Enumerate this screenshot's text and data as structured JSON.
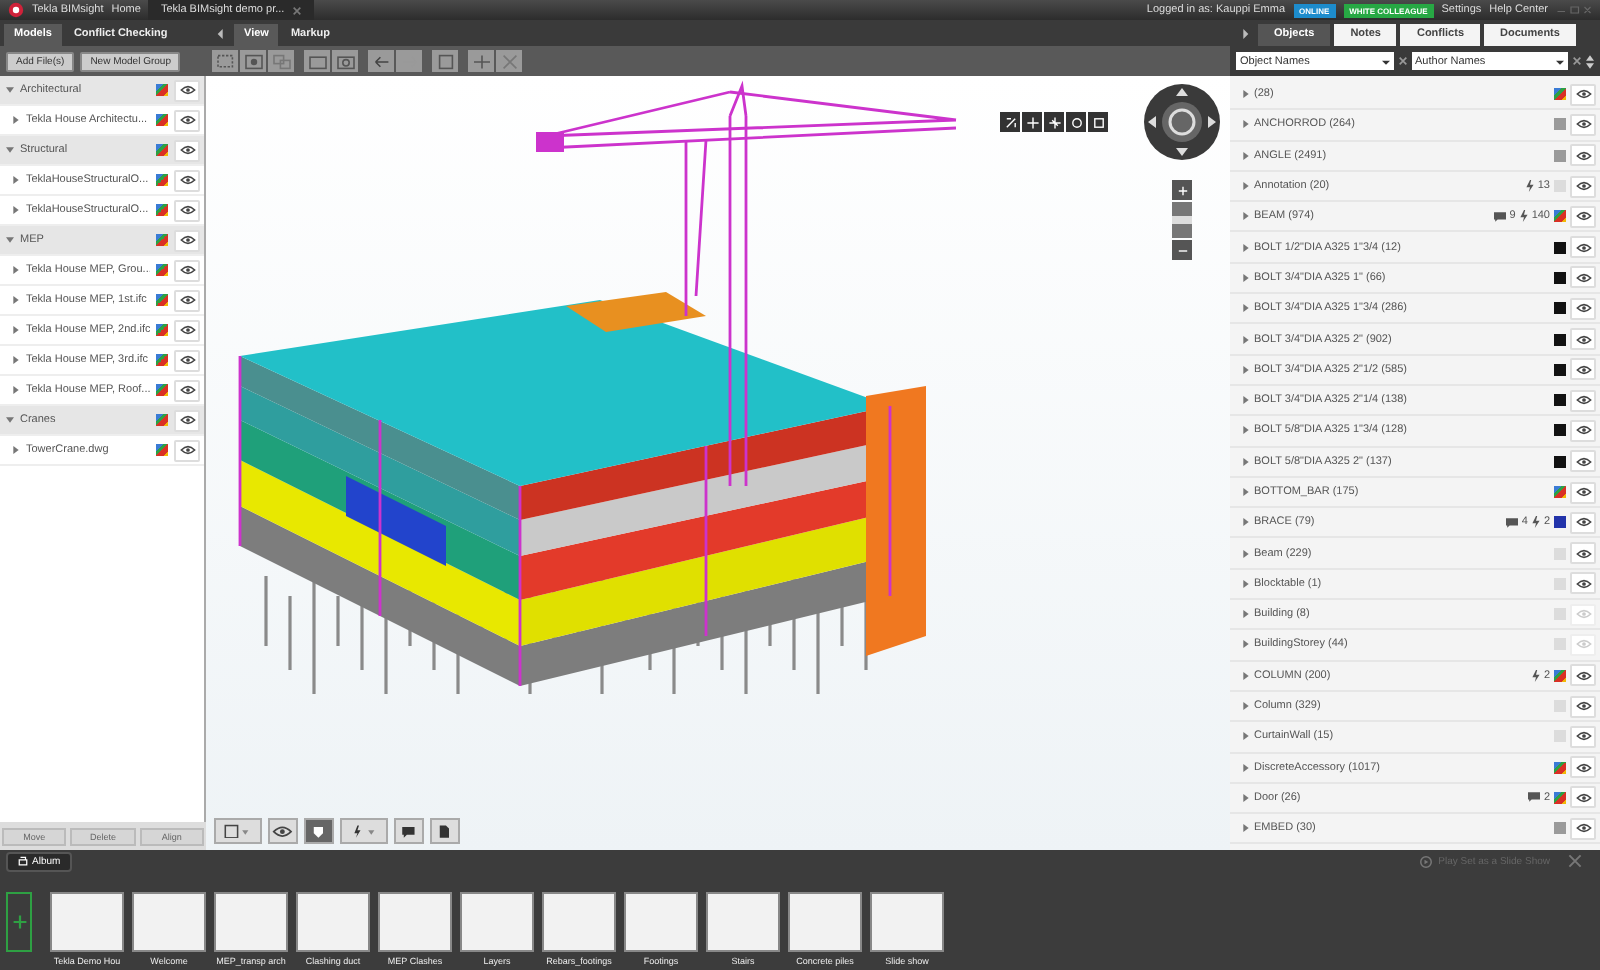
{
  "title_bar": {
    "app_name": "Tekla BIMsight",
    "home": "Home",
    "document_tab": "Tekla BIMsight demo pr...",
    "user": "Logged in as: Kauppi Emma",
    "badges": [
      {
        "label": "ONLINE",
        "color": "#1d8ccc"
      },
      {
        "label": "WHITE COLLEAGUE",
        "color": "#27a844"
      }
    ],
    "links": [
      "Settings",
      "Help Center"
    ]
  },
  "left_tabs": [
    {
      "label": "Models",
      "selected": true
    },
    {
      "label": "Conflict Checking",
      "selected": false
    }
  ],
  "view_tabs": [
    {
      "label": "View",
      "selected": true
    },
    {
      "label": "Markup",
      "selected": false
    }
  ],
  "right_tabs": [
    {
      "label": "Objects",
      "selected": true
    },
    {
      "label": "Notes",
      "selected": false
    },
    {
      "label": "Conflicts",
      "selected": false
    },
    {
      "label": "Documents",
      "selected": false
    }
  ],
  "model_buttons": [
    "Add File(s)",
    "New Model Group"
  ],
  "filters": [
    {
      "value": "Object Names"
    },
    {
      "value": "Author Names"
    }
  ],
  "model_groups": [
    {
      "name": "Architectural",
      "expanded": true,
      "children": [
        {
          "name": "Tekla House Architectu..."
        }
      ]
    },
    {
      "name": "Structural",
      "expanded": true,
      "children": [
        {
          "name": "TeklaHouseStructuralO..."
        },
        {
          "name": "TeklaHouseStructuralO..."
        }
      ]
    },
    {
      "name": "MEP",
      "expanded": true,
      "children": [
        {
          "name": "Tekla House MEP, Grou..."
        },
        {
          "name": "Tekla House MEP, 1st.ifc"
        },
        {
          "name": "Tekla House MEP, 2nd.ifc"
        },
        {
          "name": "Tekla House MEP, 3rd.ifc"
        },
        {
          "name": "Tekla House MEP, Roof..."
        }
      ]
    },
    {
      "name": "Cranes",
      "expanded": true,
      "children": [
        {
          "name": "TowerCrane.dwg"
        }
      ]
    }
  ],
  "model_footer_buttons": [
    {
      "label": "Move",
      "disabled": true
    },
    {
      "label": "Delete",
      "disabled": true
    },
    {
      "label": "Align",
      "disabled": true
    }
  ],
  "zoom_slider": {
    "level": 0.5
  },
  "objects": [
    {
      "name": "(28)",
      "multicolor": true,
      "visible": true
    },
    {
      "name": "ANCHORROD (264)",
      "multicolor": false,
      "color": "#9a9a9a",
      "visible": true
    },
    {
      "name": "ANGLE (2491)",
      "multicolor": false,
      "color": "#9a9a9a",
      "visible": true
    },
    {
      "name": "Annotation (20)",
      "multicolor": false,
      "color": "#dcdcdc",
      "conflicts": "13",
      "visible": true
    },
    {
      "name": "BEAM (974)",
      "multicolor": true,
      "comments": "9",
      "conflicts": "140",
      "visible": true
    },
    {
      "name": "BOLT 1/2\"DIA A325 1\"3/4 (12)",
      "multicolor": false,
      "color": "#111111",
      "visible": true
    },
    {
      "name": "BOLT 3/4\"DIA A325 1\" (66)",
      "multicolor": false,
      "color": "#111111",
      "visible": true
    },
    {
      "name": "BOLT 3/4\"DIA A325 1\"3/4 (286)",
      "multicolor": false,
      "color": "#111111",
      "visible": true
    },
    {
      "name": "BOLT 3/4\"DIA A325 2\" (902)",
      "multicolor": false,
      "color": "#111111",
      "visible": true
    },
    {
      "name": "BOLT 3/4\"DIA A325 2\"1/2 (585)",
      "multicolor": false,
      "color": "#111111",
      "visible": true
    },
    {
      "name": "BOLT 3/4\"DIA A325 2\"1/4 (138)",
      "multicolor": false,
      "color": "#111111",
      "visible": true
    },
    {
      "name": "BOLT 5/8\"DIA A325 1\"3/4 (128)",
      "multicolor": false,
      "color": "#111111",
      "visible": true
    },
    {
      "name": "BOLT 5/8\"DIA A325 2\" (137)",
      "multicolor": false,
      "color": "#111111",
      "visible": true
    },
    {
      "name": "BOTTOM_BAR (175)",
      "multicolor": true,
      "visible": true
    },
    {
      "name": "BRACE (79)",
      "multicolor": false,
      "color": "#2233aa",
      "comments": "4",
      "conflicts": "2",
      "visible": true
    },
    {
      "name": "Beam (229)",
      "multicolor": false,
      "color": "#dcdcdc",
      "visible": true
    },
    {
      "name": "Blocktable (1)",
      "multicolor": false,
      "color": "#dcdcdc",
      "visible": true
    },
    {
      "name": "Building (8)",
      "multicolor": false,
      "color": "#dcdcdc",
      "visible": false
    },
    {
      "name": "BuildingStorey (44)",
      "multicolor": false,
      "color": "#dcdcdc",
      "visible": false
    },
    {
      "name": "COLUMN (200)",
      "multicolor": true,
      "conflicts": "2",
      "visible": true
    },
    {
      "name": "Column (329)",
      "multicolor": false,
      "color": "#dcdcdc",
      "visible": true
    },
    {
      "name": "CurtainWall (15)",
      "multicolor": false,
      "color": "#dcdcdc",
      "visible": true
    },
    {
      "name": "DiscreteAccessory (1017)",
      "multicolor": true,
      "visible": true
    },
    {
      "name": "Door (26)",
      "multicolor": true,
      "comments": "2",
      "visible": true
    },
    {
      "name": "EMBED (30)",
      "multicolor": false,
      "color": "#9a9a9a",
      "visible": true
    }
  ],
  "album": {
    "tab": "Album",
    "slideshow_hint": "Play Set as a Slide Show",
    "slides": [
      {
        "label": "Tekla Demo Hou"
      },
      {
        "label": "Welcome"
      },
      {
        "label": "MEP_transp arch"
      },
      {
        "label": "Clashing duct"
      },
      {
        "label": "MEP Clashes"
      },
      {
        "label": "Layers"
      },
      {
        "label": "Rebars_footings"
      },
      {
        "label": "Footings"
      },
      {
        "label": "Stairs"
      },
      {
        "label": "Concrete piles"
      },
      {
        "label": "Slide show"
      }
    ]
  }
}
